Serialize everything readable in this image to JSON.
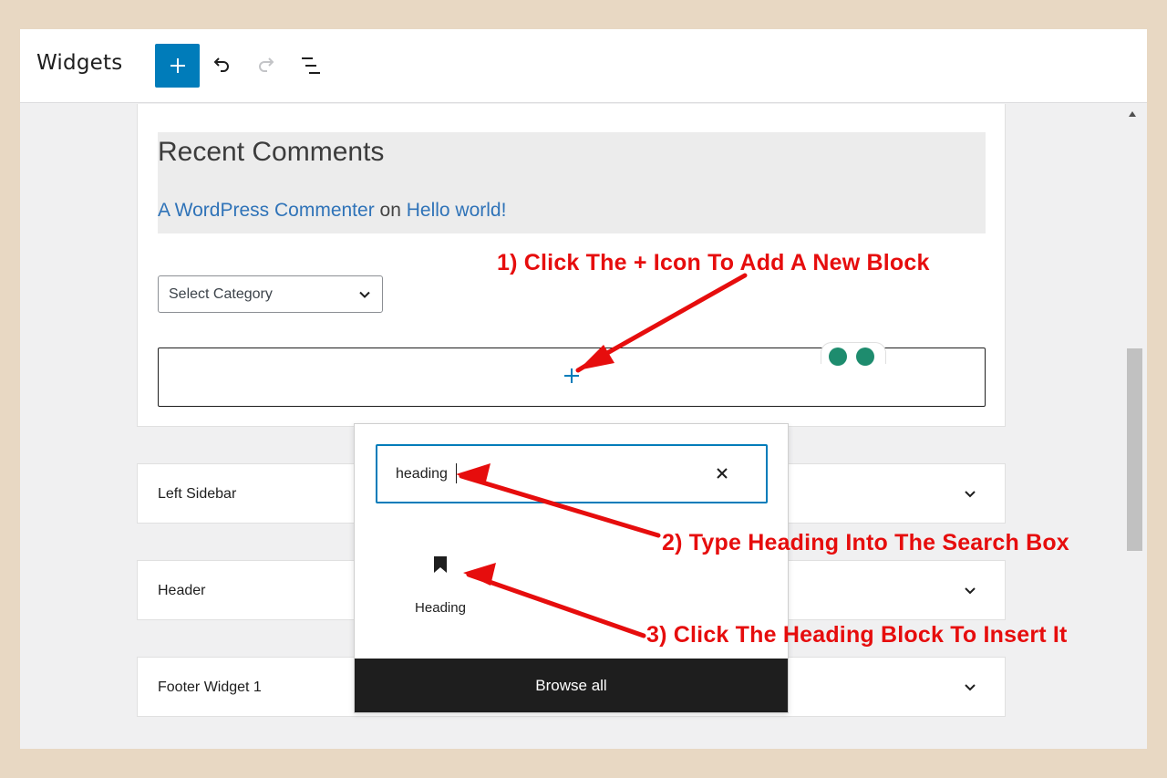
{
  "header": {
    "title": "Widgets",
    "add_block_icon": "plus-icon",
    "undo_icon": "undo-icon",
    "redo_icon": "redo-icon",
    "list_view_icon": "list-view-icon"
  },
  "recent_comments": {
    "title": "Recent Comments",
    "author": "A WordPress Commenter",
    "connector": " on ",
    "post": "Hello world!"
  },
  "category_select": {
    "selected": "Select Category"
  },
  "widget_areas": [
    {
      "label": "Left Sidebar"
    },
    {
      "label": "Header"
    },
    {
      "label": "Footer Widget 1"
    }
  ],
  "inserter": {
    "search_value": "heading",
    "results": [
      {
        "label": "Heading",
        "icon": "bookmark-icon"
      }
    ],
    "browse_all_label": "Browse all"
  },
  "annotations": {
    "step1": "1) Click The + Icon To Add A New Block",
    "step2": "2) Type Heading Into The Search Box",
    "step3": "3) Click The Heading Block To Insert It",
    "color": "#e60d0d"
  },
  "colors": {
    "accent": "#007cba",
    "link": "#2f73b8",
    "background": "#e8d8c3"
  }
}
